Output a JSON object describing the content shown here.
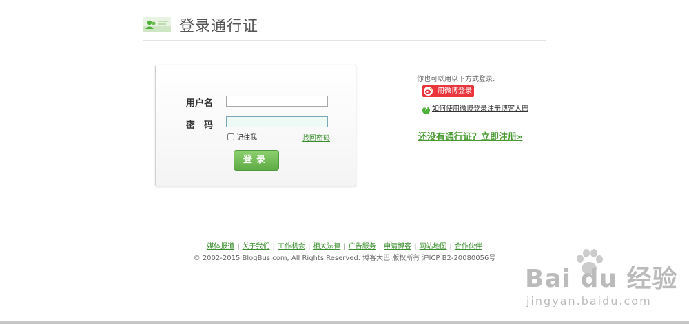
{
  "page": {
    "title": "登录通行证"
  },
  "login": {
    "username_label": "用户名",
    "password_label": "密　码",
    "username_value": "",
    "password_value": "",
    "remember_label": "记住我",
    "forgot_link": "找回密码",
    "submit_label": "登录"
  },
  "alt_login": {
    "title": "你也可以用以下方式登录:",
    "weibo_button": "用微博登录",
    "howto_link": "如何使用微博登录注册博客大巴",
    "register_link": "还没有通行证？立即注册»"
  },
  "footer": {
    "links": [
      "媒体报道",
      "关于我们",
      "工作机会",
      "相关法律",
      "广告服务",
      "申请博客",
      "网站地图",
      "合作伙伴"
    ],
    "copyright": "© 2002-2015 BlogBus.com, All Rights Reserved. 博客大巴 版权所有 沪ICP B2-20080056号"
  },
  "watermark": {
    "brand": "Bai du 经验",
    "url": "jingyan.baidu.com"
  },
  "colors": {
    "accent_green": "#5eab45",
    "link_green": "#3b8e2f",
    "weibo_red": "#e9353b"
  }
}
